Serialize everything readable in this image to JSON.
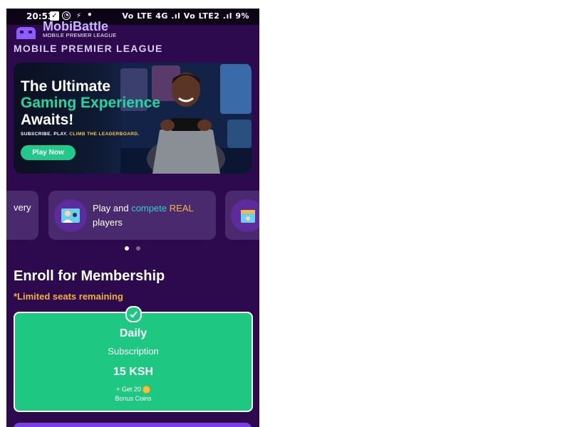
{
  "status_bar": {
    "time": "20:53",
    "right_info": "Vo LTE 4G .ıl Vo LTE2 .ıl 9%"
  },
  "header": {
    "brand_name": "MobiBattle",
    "brand_sub": "MOBILE PREMIER LEAGUE",
    "title": "MOBILE PREMIER LEAGUE"
  },
  "banner": {
    "title_line1": "The Ultimate",
    "title_line2": "Gaming Experience",
    "title_line3": "Awaits!",
    "subtitle_prefix": "SUBSCRIBE. PLAY. ",
    "subtitle_highlight": "CLIMB THE LEADERBOARD.",
    "cta_label": "Play Now"
  },
  "carousel": {
    "left_card_text": "very",
    "mid_card": {
      "text_part1": "Play and ",
      "text_part2": "compete",
      "text_part3": " ",
      "text_part4": "REAL",
      "text_part5": "players"
    },
    "active_index": 0,
    "count": 2
  },
  "membership": {
    "title": "Enroll for Membership",
    "note": "*Limited seats remaining",
    "plan": {
      "name": "Daily",
      "type": "Subscription",
      "price": "15 KSH",
      "bonus_line1": "+ Get 20",
      "bonus_line2": "Bonus Coins",
      "selected": true
    }
  },
  "colors": {
    "background": "#2d0a4e",
    "accent_green": "#1ec882",
    "accent_gold": "#f2b13c",
    "accent_teal": "#2bd2c4"
  }
}
